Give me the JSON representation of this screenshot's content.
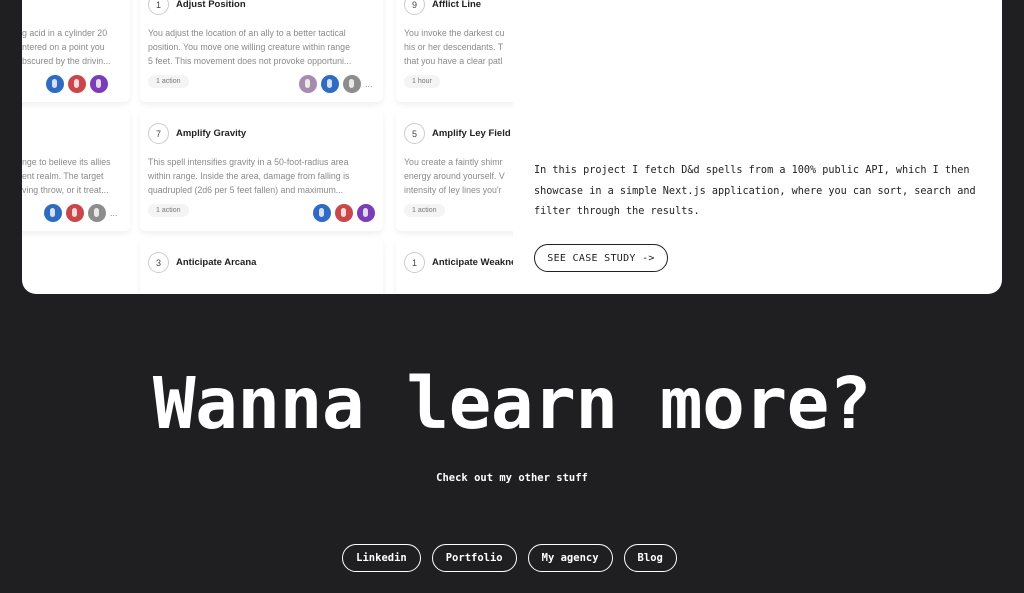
{
  "spells": {
    "row1": [
      {
        "desc": [
          "g acid in a cylinder 20",
          "ntered on a point you",
          "bscured by the drivin..."
        ],
        "icons": [
          "#2f6bc3",
          "#c9474a",
          "#7a3db8"
        ]
      },
      {
        "number": "1",
        "title": "Adjust Position",
        "desc": [
          "You adjust the location of an ally to a better tactical",
          "position. You move one willing creature within range",
          "5 feet. This movement does not provoke opportuni..."
        ],
        "badge": "1 action",
        "icons": [
          "#a88cae",
          "#2f6bc3",
          "#8d8d8d"
        ],
        "more": "..."
      },
      {
        "number": "9",
        "title": "Afflict Line",
        "desc": [
          "You invoke the darkest cu",
          "his or her descendants. T",
          "that you have a clear patl"
        ],
        "badge": "1 hour"
      }
    ],
    "row2": [
      {
        "desc": [
          "nge to believe its allies",
          "ent realm. The target",
          "ving throw, or it treat..."
        ],
        "icons": [
          "#2f6bc3",
          "#c9474a",
          "#8d8d8d"
        ],
        "more": "..."
      },
      {
        "number": "7",
        "title": "Amplify Gravity",
        "desc": [
          "This spell intensifies gravity in a 50-foot-radius area",
          "within range. Inside the area, damage from falling is",
          "quadrupled (2d6 per 5 feet fallen) and maximum..."
        ],
        "badge": "1 action",
        "icons": [
          "#2f6bc3",
          "#c9474a",
          "#7a3db8"
        ]
      },
      {
        "number": "5",
        "title": "Amplify Ley Field",
        "desc": [
          "You create a faintly shimr",
          "energy around yourself. V",
          "intensity of ley lines you'r"
        ],
        "badge": "1 action"
      }
    ],
    "row3": [
      {
        "number": "3",
        "title": "Anticipate Arcana"
      },
      {
        "number": "1",
        "title": "Anticipate Weakness"
      }
    ]
  },
  "project": {
    "description": "In this project I fetch D&d spells from a 100% public API, which I then showcase in a simple Next.js application, where you can sort, search and filter through the results.",
    "cta": "SEE CASE STUDY ->"
  },
  "footer": {
    "headline": "Wanna learn more?",
    "subtitle": "Check out my other stuff",
    "links": [
      "Linkedin",
      "Portfolio",
      "My agency",
      "Blog"
    ]
  }
}
